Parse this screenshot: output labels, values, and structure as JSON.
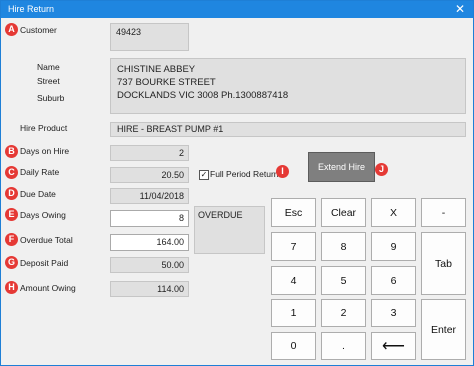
{
  "window": {
    "title": "Hire Return",
    "close": "✕"
  },
  "markers": {
    "A": "A",
    "B": "B",
    "C": "C",
    "D": "D",
    "E": "E",
    "F": "F",
    "G": "G",
    "H": "H",
    "I": "I",
    "J": "J"
  },
  "labels": {
    "customer": "Customer",
    "name": "Name",
    "street": "Street",
    "suburb": "Suburb",
    "hire_product": "Hire Product",
    "days_on_hire": "Days on Hire",
    "daily_rate": "Daily Rate",
    "due_date": "Due Date",
    "days_owing": "Days Owing",
    "overdue_total": "Overdue Total",
    "deposit_paid": "Deposit Paid",
    "amount_owing": "Amount Owing"
  },
  "values": {
    "customer": "49423",
    "name": "CHISTINE ABBEY",
    "street": "737 BOURKE STREET",
    "suburb": "DOCKLANDS VIC 3008  Ph.1300887418",
    "hire_product": "HIRE - BREAST PUMP #1",
    "days_on_hire": "2",
    "daily_rate": "20.50",
    "due_date": "11/04/2018",
    "days_owing": "8",
    "overdue_total": "164.00",
    "deposit_paid": "50.00",
    "amount_owing": "114.00",
    "status": "OVERDUE"
  },
  "full_period_return": {
    "label": "Full Period Return",
    "checked": "✓"
  },
  "extend_hire": "Extend Hire",
  "keypad": {
    "esc": "Esc",
    "clear": "Clear",
    "x": "X",
    "minus": "-",
    "k7": "7",
    "k8": "8",
    "k9": "9",
    "tab": "Tab",
    "k4": "4",
    "k5": "5",
    "k6": "6",
    "k1": "1",
    "k2": "2",
    "k3": "3",
    "enter": "Enter",
    "k0": "0",
    "dot": ".",
    "back": "⟵"
  }
}
